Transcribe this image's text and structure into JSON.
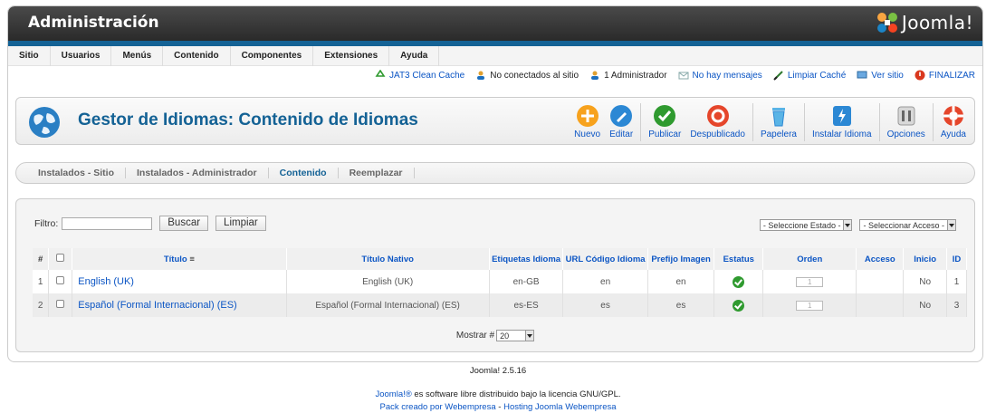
{
  "header": {
    "title": "Administración",
    "brand": "Joomla!"
  },
  "menu": [
    "Sitio",
    "Usuarios",
    "Menús",
    "Contenido",
    "Componentes",
    "Extensiones",
    "Ayuda"
  ],
  "status": {
    "cache": "JAT3 Clean Cache",
    "visitors": "No conectados al sitio",
    "admins": "1 Administrador",
    "messages": "No hay mensajes",
    "clean_cache": "Limpiar Caché",
    "view_site": "Ver sitio",
    "logout": "FINALIZAR"
  },
  "toolbar": {
    "title": "Gestor de Idiomas: Contenido de Idiomas",
    "buttons": {
      "new": "Nuevo",
      "edit": "Editar",
      "publish": "Publicar",
      "unpublish": "Despublicado",
      "trash": "Papelera",
      "install": "Instalar Idioma",
      "options": "Opciones",
      "help": "Ayuda"
    }
  },
  "tabs": [
    "Instalados - Sitio",
    "Instalados - Administrador",
    "Contenido",
    "Reemplazar"
  ],
  "filter": {
    "label": "Filtro:",
    "value": "",
    "search_button": "Buscar",
    "clear_button": "Limpiar",
    "state_select": "- Seleccione Estado -",
    "access_select": "- Seleccionar Acceso -"
  },
  "table": {
    "headers": [
      "#",
      "",
      "Título",
      "Título Nativo",
      "Etiquetas Idioma",
      "URL Código Idioma",
      "Prefijo Imagen",
      "Estatus",
      "Orden",
      "Acceso",
      "Inicio",
      "ID"
    ],
    "rows": [
      {
        "num": "1",
        "title": "English (UK)",
        "native": "English (UK)",
        "tag": "en-GB",
        "url": "en",
        "image": "en",
        "order": "1",
        "access": "",
        "home": "No",
        "id": "1"
      },
      {
        "num": "2",
        "title": "Español (Formal Internacional) (ES)",
        "native": "Español (Formal Internacional) (ES)",
        "tag": "es-ES",
        "url": "es",
        "image": "es",
        "order": "1",
        "access": "",
        "home": "No",
        "id": "3"
      }
    ]
  },
  "pager": {
    "label": "Mostrar #",
    "value": "20"
  },
  "footer": {
    "version": "Joomla! 2.5.16",
    "license_link": "Joomla!®",
    "license_text": " es software libre distribuido bajo la licencia GNU/GPL.",
    "pack_link": "Pack creado por Webempresa",
    "sep": " - ",
    "hosting_link": "Hosting Joomla Webempresa"
  },
  "colors": {
    "accent": "#146295",
    "link": "#0b55c4",
    "header": "#2a2a2a"
  }
}
